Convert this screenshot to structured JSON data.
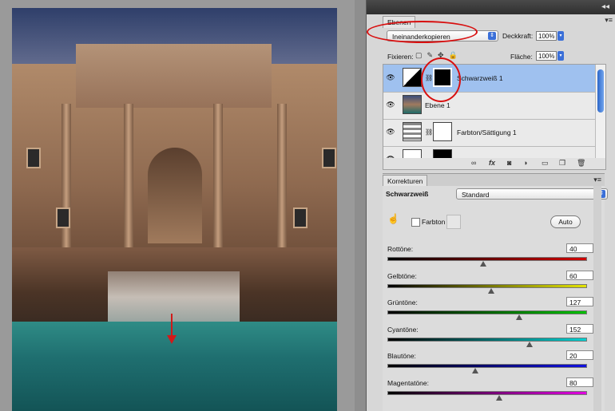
{
  "layers_panel": {
    "tab": "Ebenen",
    "blend_mode": "Ineinanderkopieren",
    "opacity_label": "Deckkraft:",
    "opacity_value": "100%",
    "lock_label": "Fixieren:",
    "fill_label": "Fläche:",
    "fill_value": "100%",
    "layers": [
      {
        "name": "Schwarzweiß 1",
        "selected": true
      },
      {
        "name": "Ebene 1",
        "selected": false
      },
      {
        "name": "Farbton/Sättigung 1",
        "selected": false
      }
    ],
    "toolbar_icons": [
      "link-icon",
      "fx-icon",
      "mask-icon",
      "adjustment-icon",
      "group-icon",
      "new-layer-icon",
      "trash-icon"
    ]
  },
  "corrections_panel": {
    "tab": "Korrekturen",
    "adjustment_name": "Schwarzweiß",
    "preset": "Standard",
    "tint_label": "Farbton",
    "auto_label": "Auto",
    "sliders": [
      {
        "label": "Rottöne:",
        "value": "40",
        "position": 0.48,
        "gradient": "linear-gradient(90deg,#000,#d00000)"
      },
      {
        "label": "Gelbtöne:",
        "value": "60",
        "position": 0.52,
        "gradient": "linear-gradient(90deg,#000,#e3e300)"
      },
      {
        "label": "Grüntöne:",
        "value": "127",
        "position": 0.66,
        "gradient": "linear-gradient(90deg,#000,#00c000)"
      },
      {
        "label": "Cyantöne:",
        "value": "152",
        "position": 0.71,
        "gradient": "linear-gradient(90deg,#000,#00d0d0)"
      },
      {
        "label": "Blautöne:",
        "value": "20",
        "position": 0.44,
        "gradient": "linear-gradient(90deg,#000,#1010e0)"
      },
      {
        "label": "Magentatöne:",
        "value": "80",
        "position": 0.56,
        "gradient": "linear-gradient(90deg,#000,#e000e0)"
      }
    ]
  },
  "colors": {
    "annotation_red": "#d80f0f",
    "selection_blue": "#9fc1ef"
  }
}
